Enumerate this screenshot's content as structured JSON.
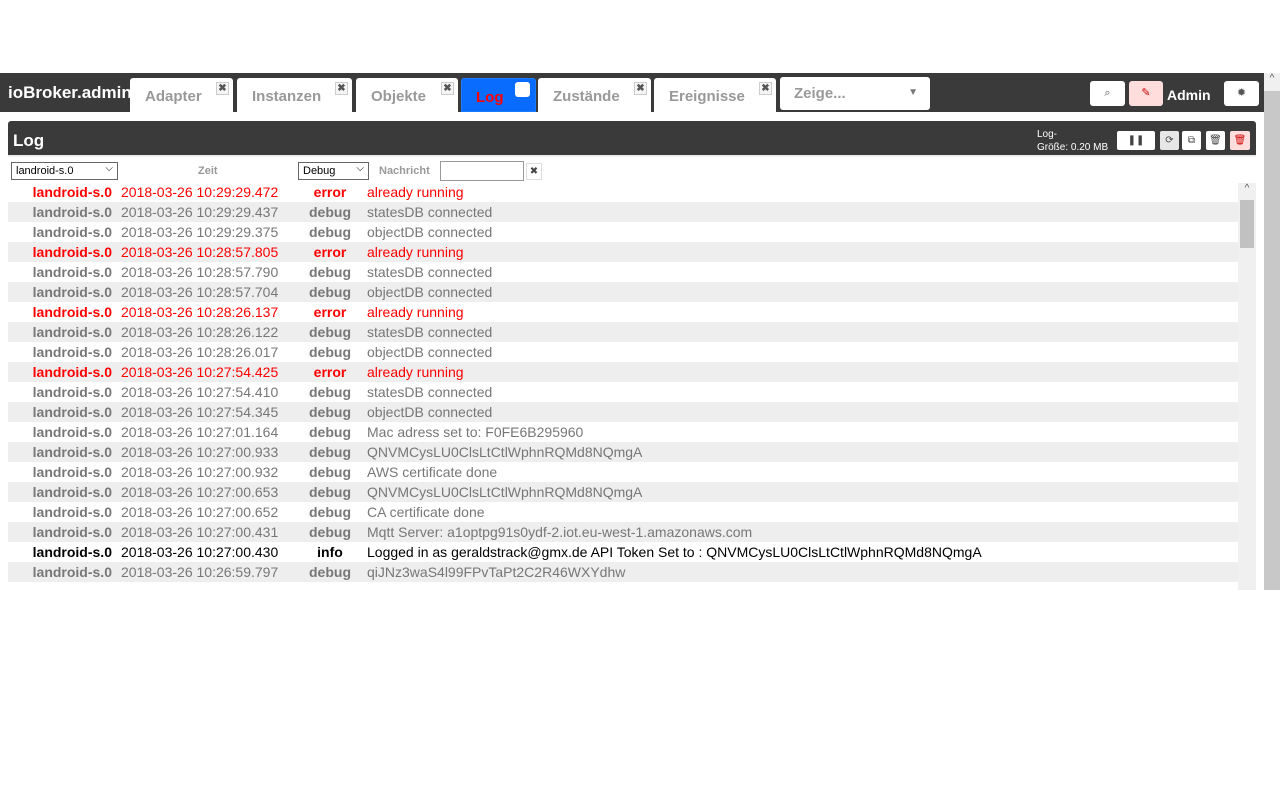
{
  "app": {
    "title": "ioBroker.admin",
    "user": "Admin"
  },
  "tabs": [
    {
      "label": "Adapter"
    },
    {
      "label": "Instanzen"
    },
    {
      "label": "Objekte"
    },
    {
      "label": "Log",
      "active": true
    },
    {
      "label": "Zustände"
    },
    {
      "label": "Ereignisse"
    }
  ],
  "show_select": "Zeige...",
  "log": {
    "title": "Log",
    "size_label": "Log-",
    "size_value": "Größe: 0.20 MB",
    "filters": {
      "source": "landroid-s.0",
      "time_label": "Zeit",
      "level": "Debug",
      "message_label": "Nachricht",
      "message_value": ""
    },
    "rows": [
      {
        "src": "landroid-s.0",
        "time": "2018-03-26 10:29:29.472",
        "sev": "error",
        "msg": "already running"
      },
      {
        "src": "landroid-s.0",
        "time": "2018-03-26 10:29:29.437",
        "sev": "debug",
        "msg": "statesDB connected"
      },
      {
        "src": "landroid-s.0",
        "time": "2018-03-26 10:29:29.375",
        "sev": "debug",
        "msg": "objectDB connected"
      },
      {
        "src": "landroid-s.0",
        "time": "2018-03-26 10:28:57.805",
        "sev": "error",
        "msg": "already running"
      },
      {
        "src": "landroid-s.0",
        "time": "2018-03-26 10:28:57.790",
        "sev": "debug",
        "msg": "statesDB connected"
      },
      {
        "src": "landroid-s.0",
        "time": "2018-03-26 10:28:57.704",
        "sev": "debug",
        "msg": "objectDB connected"
      },
      {
        "src": "landroid-s.0",
        "time": "2018-03-26 10:28:26.137",
        "sev": "error",
        "msg": "already running"
      },
      {
        "src": "landroid-s.0",
        "time": "2018-03-26 10:28:26.122",
        "sev": "debug",
        "msg": "statesDB connected"
      },
      {
        "src": "landroid-s.0",
        "time": "2018-03-26 10:28:26.017",
        "sev": "debug",
        "msg": "objectDB connected"
      },
      {
        "src": "landroid-s.0",
        "time": "2018-03-26 10:27:54.425",
        "sev": "error",
        "msg": "already running"
      },
      {
        "src": "landroid-s.0",
        "time": "2018-03-26 10:27:54.410",
        "sev": "debug",
        "msg": "statesDB connected"
      },
      {
        "src": "landroid-s.0",
        "time": "2018-03-26 10:27:54.345",
        "sev": "debug",
        "msg": "objectDB connected"
      },
      {
        "src": "landroid-s.0",
        "time": "2018-03-26 10:27:01.164",
        "sev": "debug",
        "msg": "Mac adress set to: F0FE6B295960"
      },
      {
        "src": "landroid-s.0",
        "time": "2018-03-26 10:27:00.933",
        "sev": "debug",
        "msg": "QNVMCysLU0ClsLtCtlWphnRQMd8NQmgA"
      },
      {
        "src": "landroid-s.0",
        "time": "2018-03-26 10:27:00.932",
        "sev": "debug",
        "msg": "AWS certificate done"
      },
      {
        "src": "landroid-s.0",
        "time": "2018-03-26 10:27:00.653",
        "sev": "debug",
        "msg": "QNVMCysLU0ClsLtCtlWphnRQMd8NQmgA"
      },
      {
        "src": "landroid-s.0",
        "time": "2018-03-26 10:27:00.652",
        "sev": "debug",
        "msg": "CA certificate done"
      },
      {
        "src": "landroid-s.0",
        "time": "2018-03-26 10:27:00.431",
        "sev": "debug",
        "msg": "Mqtt Server: a1optpg91s0ydf-2.iot.eu-west-1.amazonaws.com"
      },
      {
        "src": "landroid-s.0",
        "time": "2018-03-26 10:27:00.430",
        "sev": "info",
        "msg": "Logged in as geraldstrack@gmx.de API Token Set to : QNVMCysLU0ClsLtCtlWphnRQMd8NQmgA"
      },
      {
        "src": "landroid-s.0",
        "time": "2018-03-26 10:26:59.797",
        "sev": "debug",
        "msg": "qiJNz3waS4l99FPvTaPt2C2R46WXYdhw"
      }
    ]
  }
}
